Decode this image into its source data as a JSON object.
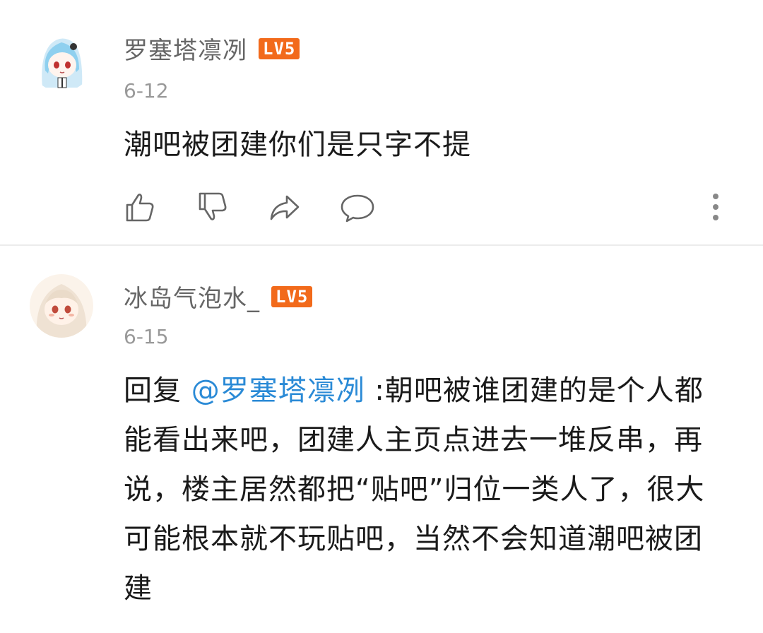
{
  "comments": [
    {
      "username": "罗塞塔凛冽",
      "level": "LV5",
      "date": "6-12",
      "content": "潮吧被团建你们是只字不提"
    },
    {
      "username": "冰岛气泡水_",
      "level": "LV5",
      "date": "6-15",
      "reply_prefix": "回复 ",
      "mention": "@罗塞塔凛冽",
      "content": " :朝吧被谁团建的是个人都能看出来吧，团建人主页点进去一堆反串，再说，楼主居然都把“贴吧”归位一类人了，很大可能根本就不玩贴吧，当然不会知道潮吧被团建"
    }
  ],
  "icons": [
    "like-icon",
    "dislike-icon",
    "share-icon",
    "comment-icon",
    "more-icon"
  ],
  "colors": {
    "level_badge": "#f26a1b",
    "mention": "#2a8ad6",
    "username": "#666666",
    "date": "#999999"
  }
}
